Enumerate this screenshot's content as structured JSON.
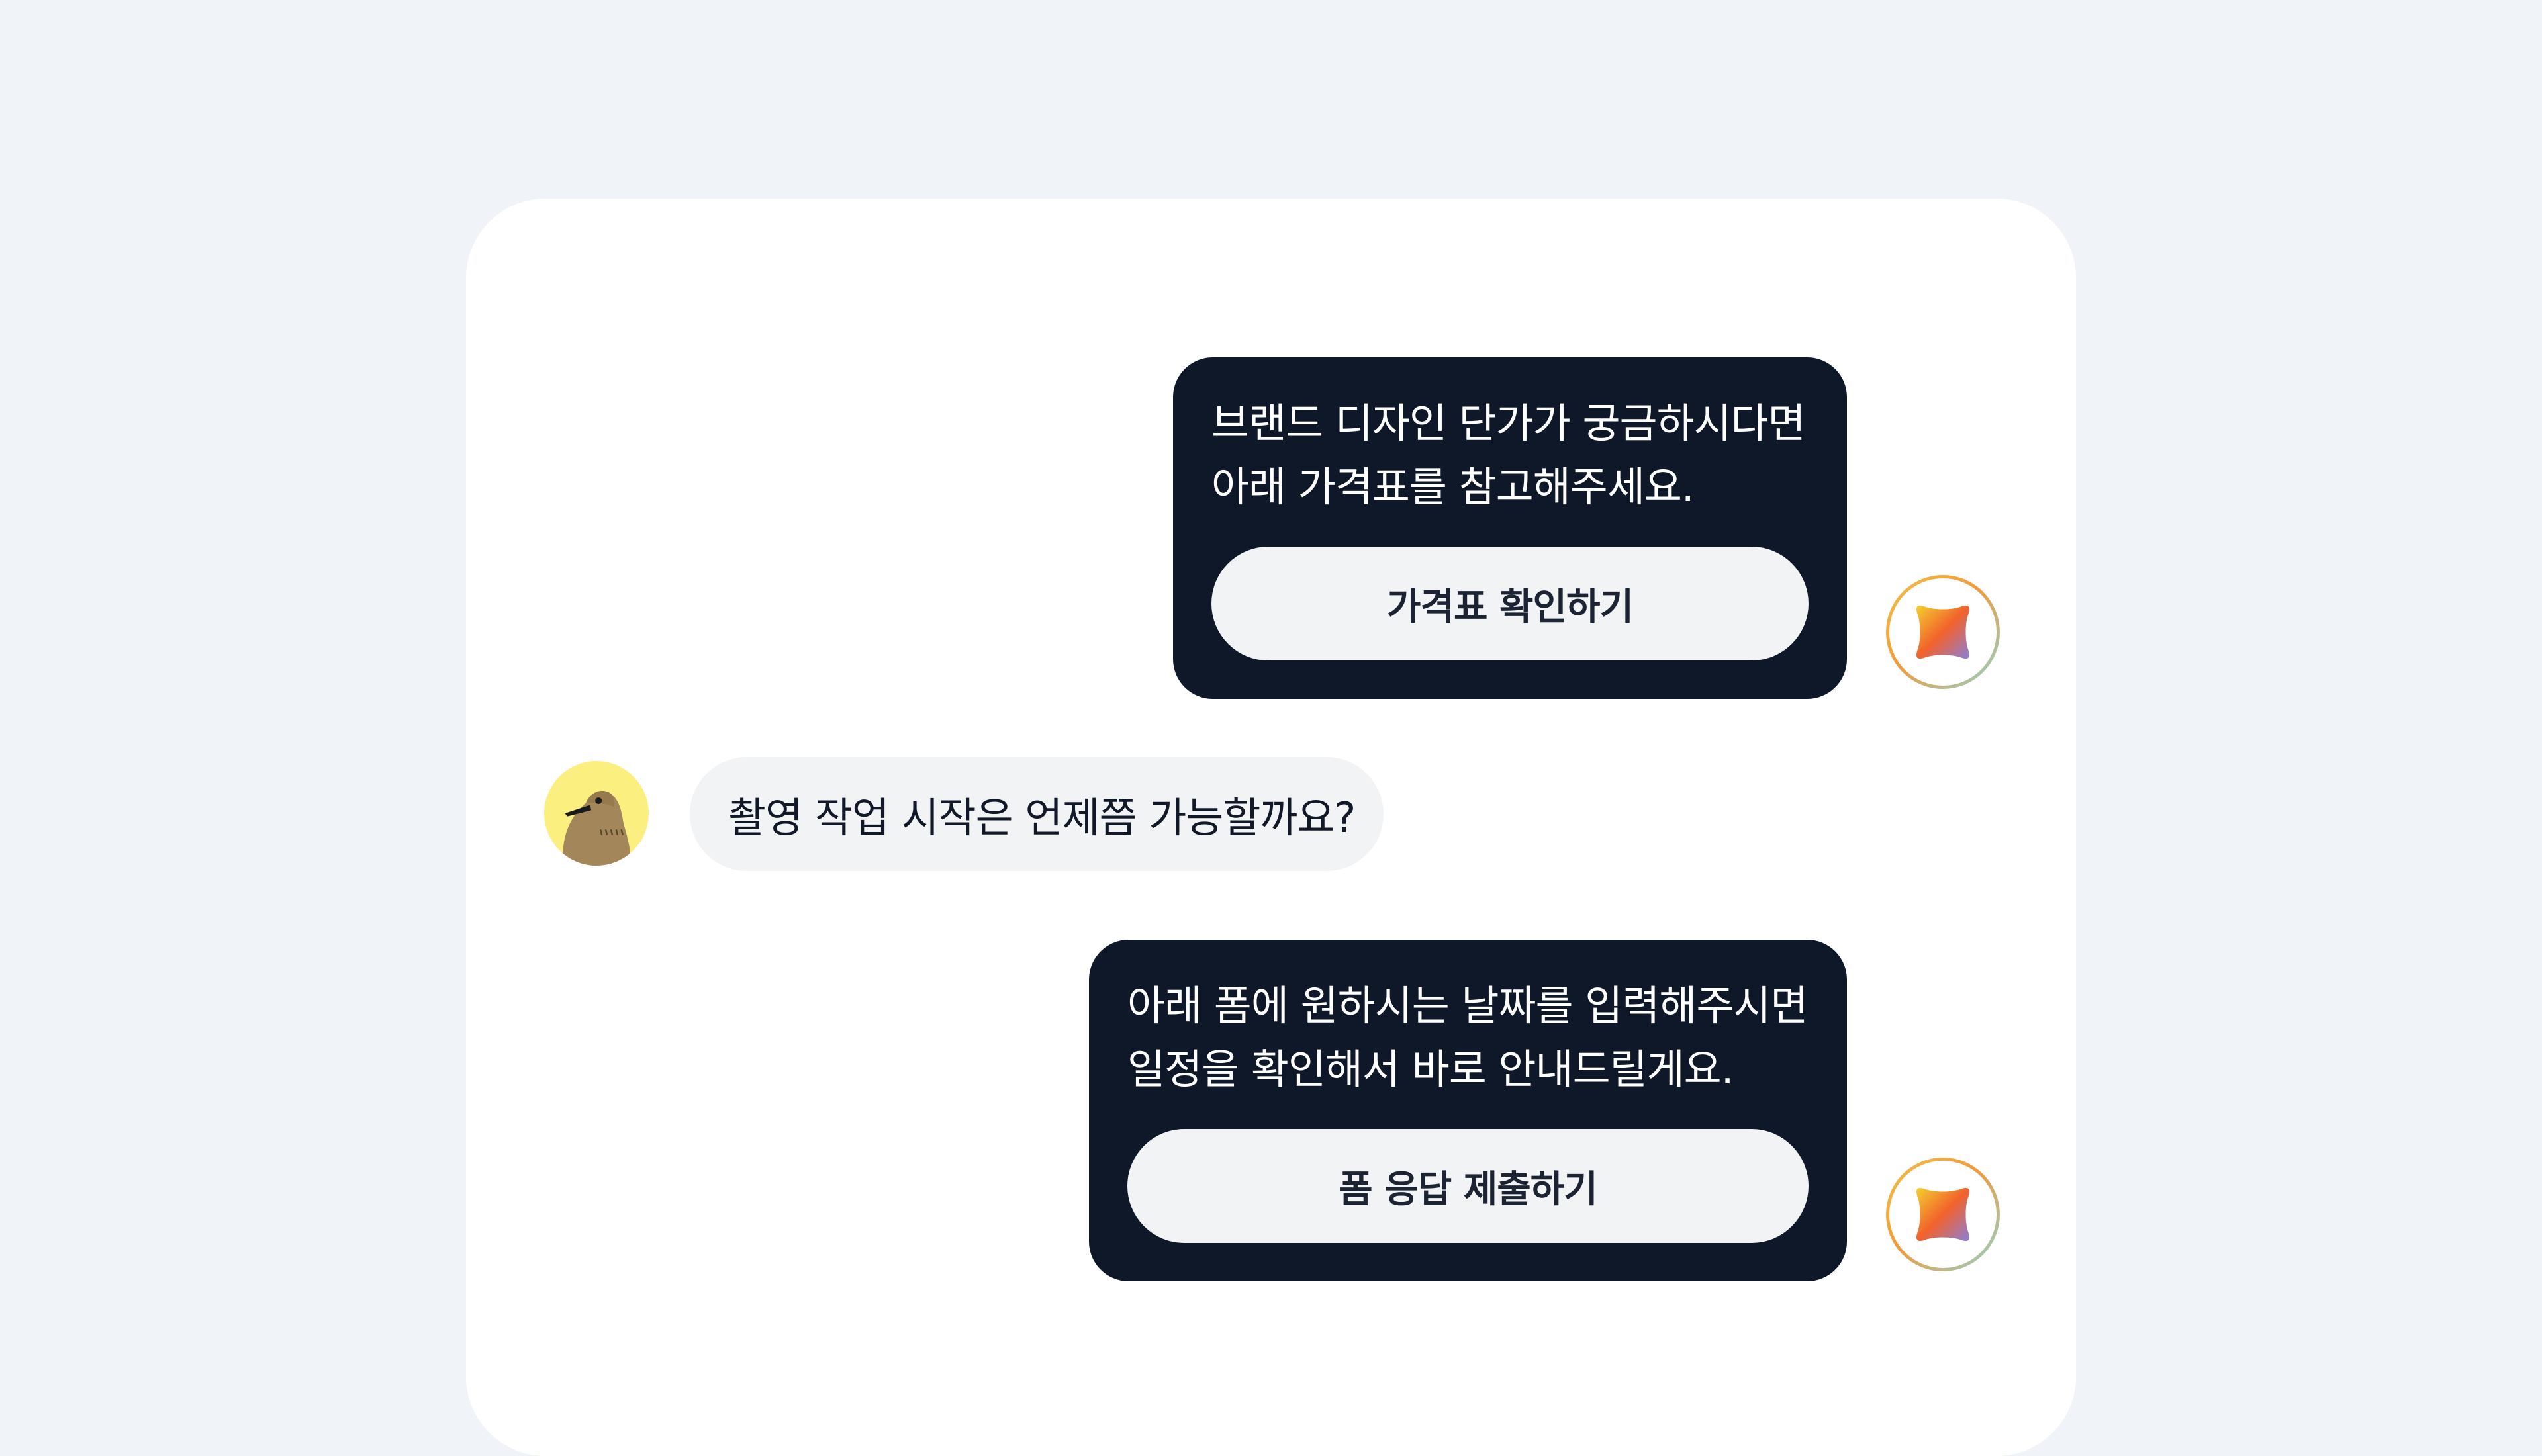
{
  "messages": [
    {
      "sender": "bot",
      "text": "브랜드 디자인 단가가 궁금하시다면\n아래 가격표를 참고해주세요.",
      "button_label": "가격표 확인하기",
      "avatar_icon": "brand-logo-icon"
    },
    {
      "sender": "user",
      "text": "촬영 작업 시작은 언제쯤 가능할까요?",
      "avatar_icon": "bird-avatar-icon"
    },
    {
      "sender": "bot",
      "text": "아래 폼에 원하시는 날짜를 입력해주시면\n일정을 확인해서 바로 안내드릴게요.",
      "button_label": "폼 응답 제출하기",
      "avatar_icon": "brand-logo-icon"
    }
  ],
  "colors": {
    "page_background": "#f0f3f7",
    "panel_background": "#ffffff",
    "bot_bubble": "#0f1828",
    "button_background": "#f2f3f5",
    "user_bubble": "#f2f3f5",
    "user_avatar_background": "#fbef7f",
    "logo_gradient": [
      "#f4d02f",
      "#f2622c",
      "#8a7fd8"
    ]
  }
}
